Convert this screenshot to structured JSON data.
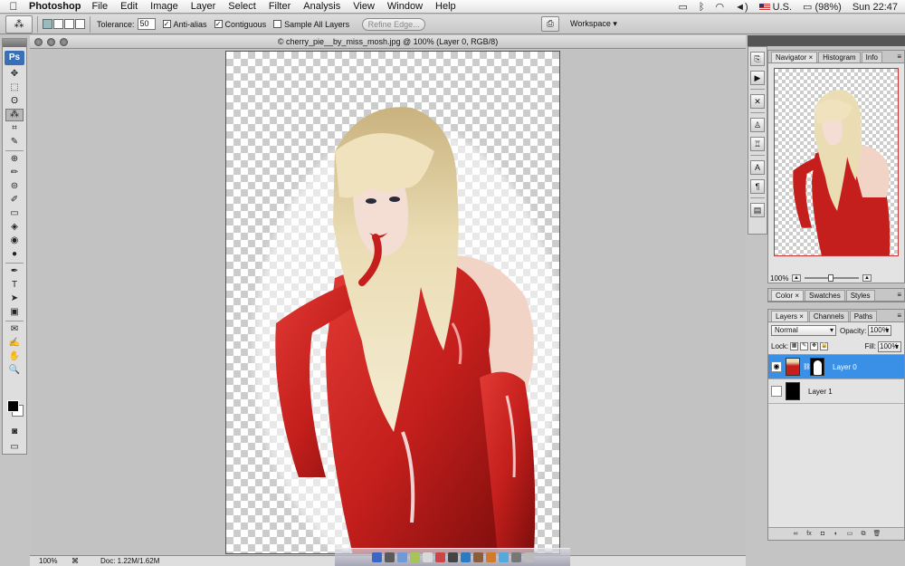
{
  "menubar": {
    "apple_glyph": "",
    "app_name": "Photoshop",
    "menus": [
      "File",
      "Edit",
      "Image",
      "Layer",
      "Select",
      "Filter",
      "Analysis",
      "View",
      "Window",
      "Help"
    ],
    "keyboard_layout": "U.S.",
    "battery": "(98%)",
    "clock": "Sun 22:47"
  },
  "options": {
    "tolerance_label": "Tolerance:",
    "tolerance_value": "50",
    "anti_alias": "Anti-alias",
    "contiguous": "Contiguous",
    "sample_all": "Sample All Layers",
    "refine_edge": "Refine Edge...",
    "workspace": "Workspace ▾"
  },
  "toolbox": {
    "logo": "Ps",
    "tools": [
      "move-tool",
      "marquee-tool",
      "lasso-tool",
      "magic-wand-tool",
      "crop-tool",
      "slice-tool",
      "healing-tool",
      "brush-tool",
      "clone-stamp-tool",
      "history-brush-tool",
      "eraser-tool",
      "paint-bucket-tool",
      "blur-tool",
      "dodge-tool",
      "pen-tool",
      "type-tool",
      "path-selection-tool",
      "shape-tool",
      "notes-tool",
      "eyedropper-tool",
      "hand-tool",
      "zoom-tool"
    ],
    "glyphs": [
      "✥",
      "⬚",
      "ʘ",
      "⁂",
      "⌗",
      "✎",
      "⊕",
      "✏",
      "⊜",
      "✐",
      "▭",
      "◈",
      "◉",
      "●",
      "✒",
      "T",
      "➤",
      "▣",
      "✉",
      "✍",
      "✋",
      "🔍"
    ]
  },
  "document": {
    "title": "© cherry_pie__by_miss_mosh.jpg @ 100% (Layer 0, RGB/8)",
    "zoom": "100%",
    "doc_size": "Doc: 1.22M/1.62M"
  },
  "navigator": {
    "tabs": [
      "Navigator ×",
      "Histogram",
      "Info"
    ],
    "zoom": "100%"
  },
  "color_panel": {
    "tabs": [
      "Color ×",
      "Swatches",
      "Styles"
    ]
  },
  "layers_panel": {
    "tabs": [
      "Layers ×",
      "Channels",
      "Paths"
    ],
    "blend_mode": "Normal",
    "opacity_label": "Opacity:",
    "opacity_value": "100%",
    "lock_label": "Lock:",
    "fill_label": "Fill:",
    "fill_value": "100%",
    "layers": [
      {
        "name": "Layer 0",
        "visible": true,
        "selected": true
      },
      {
        "name": "Layer 1",
        "visible": false,
        "selected": false
      }
    ]
  },
  "colors": {
    "accent_selected": "#3a8fe6",
    "latex_red": "#c41f1c",
    "hair_blonde": "#e8d9ad"
  }
}
